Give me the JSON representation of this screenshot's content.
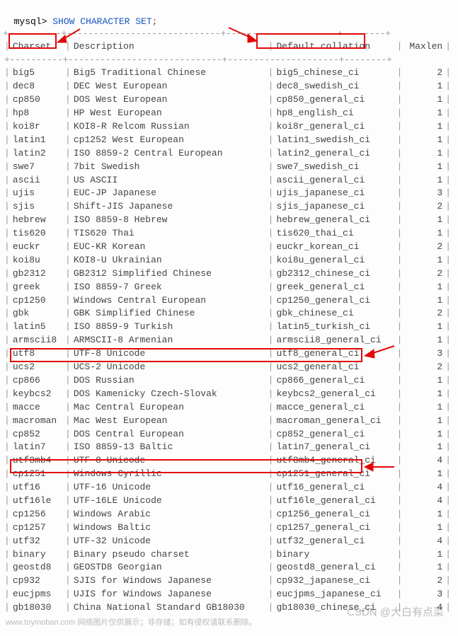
{
  "prompt": "mysql>",
  "statement": "SHOW CHARACTER SET",
  "semicolon": ";",
  "header_dashes": "+----------+-----------------------------+---------------------+--------+",
  "headers": {
    "charset": "Charset",
    "description": "Description",
    "collation": "Default collation",
    "maxlen": "Maxlen"
  },
  "rows": [
    {
      "charset": "big5",
      "description": "Big5 Traditional Chinese",
      "collation": "big5_chinese_ci",
      "maxlen": "2"
    },
    {
      "charset": "dec8",
      "description": "DEC West European",
      "collation": "dec8_swedish_ci",
      "maxlen": "1"
    },
    {
      "charset": "cp850",
      "description": "DOS West European",
      "collation": "cp850_general_ci",
      "maxlen": "1"
    },
    {
      "charset": "hp8",
      "description": "HP West European",
      "collation": "hp8_english_ci",
      "maxlen": "1"
    },
    {
      "charset": "koi8r",
      "description": "KOI8-R Relcom Russian",
      "collation": "koi8r_general_ci",
      "maxlen": "1"
    },
    {
      "charset": "latin1",
      "description": "cp1252 West European",
      "collation": "latin1_swedish_ci",
      "maxlen": "1"
    },
    {
      "charset": "latin2",
      "description": "ISO 8859-2 Central European",
      "collation": "latin2_general_ci",
      "maxlen": "1"
    },
    {
      "charset": "swe7",
      "description": "7bit Swedish",
      "collation": "swe7_swedish_ci",
      "maxlen": "1"
    },
    {
      "charset": "ascii",
      "description": "US ASCII",
      "collation": "ascii_general_ci",
      "maxlen": "1"
    },
    {
      "charset": "ujis",
      "description": "EUC-JP Japanese",
      "collation": "ujis_japanese_ci",
      "maxlen": "3"
    },
    {
      "charset": "sjis",
      "description": "Shift-JIS Japanese",
      "collation": "sjis_japanese_ci",
      "maxlen": "2"
    },
    {
      "charset": "hebrew",
      "description": "ISO 8859-8 Hebrew",
      "collation": "hebrew_general_ci",
      "maxlen": "1"
    },
    {
      "charset": "tis620",
      "description": "TIS620 Thai",
      "collation": "tis620_thai_ci",
      "maxlen": "1"
    },
    {
      "charset": "euckr",
      "description": "EUC-KR Korean",
      "collation": "euckr_korean_ci",
      "maxlen": "2"
    },
    {
      "charset": "koi8u",
      "description": "KOI8-U Ukrainian",
      "collation": "koi8u_general_ci",
      "maxlen": "1"
    },
    {
      "charset": "gb2312",
      "description": "GB2312 Simplified Chinese",
      "collation": "gb2312_chinese_ci",
      "maxlen": "2"
    },
    {
      "charset": "greek",
      "description": "ISO 8859-7 Greek",
      "collation": "greek_general_ci",
      "maxlen": "1"
    },
    {
      "charset": "cp1250",
      "description": "Windows Central European",
      "collation": "cp1250_general_ci",
      "maxlen": "1"
    },
    {
      "charset": "gbk",
      "description": "GBK Simplified Chinese",
      "collation": "gbk_chinese_ci",
      "maxlen": "2"
    },
    {
      "charset": "latin5",
      "description": "ISO 8859-9 Turkish",
      "collation": "latin5_turkish_ci",
      "maxlen": "1"
    },
    {
      "charset": "armscii8",
      "description": "ARMSCII-8 Armenian",
      "collation": "armscii8_general_ci",
      "maxlen": "1"
    },
    {
      "charset": "utf8",
      "description": "UTF-8 Unicode",
      "collation": "utf8_general_ci",
      "maxlen": "3"
    },
    {
      "charset": "ucs2",
      "description": "UCS-2 Unicode",
      "collation": "ucs2_general_ci",
      "maxlen": "2"
    },
    {
      "charset": "cp866",
      "description": "DOS Russian",
      "collation": "cp866_general_ci",
      "maxlen": "1"
    },
    {
      "charset": "keybcs2",
      "description": "DOS Kamenicky Czech-Slovak",
      "collation": "keybcs2_general_ci",
      "maxlen": "1"
    },
    {
      "charset": "macce",
      "description": "Mac Central European",
      "collation": "macce_general_ci",
      "maxlen": "1"
    },
    {
      "charset": "macroman",
      "description": "Mac West European",
      "collation": "macroman_general_ci",
      "maxlen": "1"
    },
    {
      "charset": "cp852",
      "description": "DOS Central European",
      "collation": "cp852_general_ci",
      "maxlen": "1"
    },
    {
      "charset": "latin7",
      "description": "ISO 8859-13 Baltic",
      "collation": "latin7_general_ci",
      "maxlen": "1"
    },
    {
      "charset": "utf8mb4",
      "description": "UTF-8 Unicode",
      "collation": "utf8mb4_general_ci",
      "maxlen": "4"
    },
    {
      "charset": "cp1251",
      "description": "Windows Cyrillic",
      "collation": "cp1251_general_ci",
      "maxlen": "1"
    },
    {
      "charset": "utf16",
      "description": "UTF-16 Unicode",
      "collation": "utf16_general_ci",
      "maxlen": "4"
    },
    {
      "charset": "utf16le",
      "description": "UTF-16LE Unicode",
      "collation": "utf16le_general_ci",
      "maxlen": "4"
    },
    {
      "charset": "cp1256",
      "description": "Windows Arabic",
      "collation": "cp1256_general_ci",
      "maxlen": "1"
    },
    {
      "charset": "cp1257",
      "description": "Windows Baltic",
      "collation": "cp1257_general_ci",
      "maxlen": "1"
    },
    {
      "charset": "utf32",
      "description": "UTF-32 Unicode",
      "collation": "utf32_general_ci",
      "maxlen": "4"
    },
    {
      "charset": "binary",
      "description": "Binary pseudo charset",
      "collation": "binary",
      "maxlen": "1"
    },
    {
      "charset": "geostd8",
      "description": "GEOSTD8 Georgian",
      "collation": "geostd8_general_ci",
      "maxlen": "1"
    },
    {
      "charset": "cp932",
      "description": "SJIS for Windows Japanese",
      "collation": "cp932_japanese_ci",
      "maxlen": "2"
    },
    {
      "charset": "eucjpms",
      "description": "UJIS for Windows Japanese",
      "collation": "eucjpms_japanese_ci",
      "maxlen": "3"
    },
    {
      "charset": "gb18030",
      "description": "China National Standard GB18030",
      "collation": "gb18030_chinese_ci",
      "maxlen": "4"
    }
  ],
  "watermark_csdn": "CSDN @大白有点菜",
  "watermark_bottom": "www.toymoban.com   网络图片仅供展示；非存储；如有侵权请联系删除。"
}
